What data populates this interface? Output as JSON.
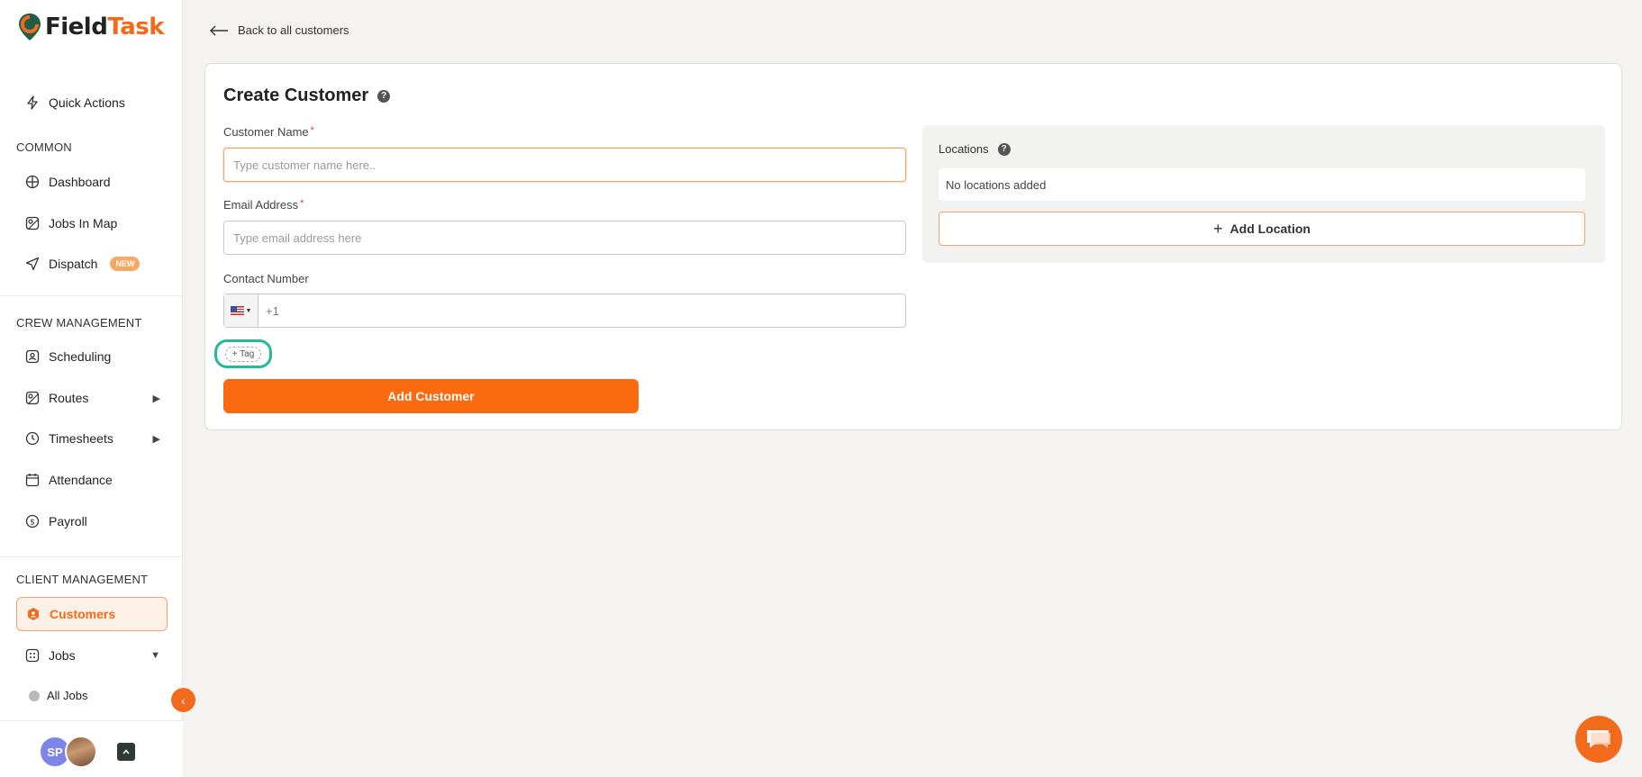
{
  "brand": {
    "name_part1": "Field",
    "name_part2": "Task",
    "accent": "#f26a1b"
  },
  "sidebar": {
    "quick_actions": "Quick Actions",
    "sections": {
      "common": "COMMON",
      "crew": "CREW MANAGEMENT",
      "client": "CLIENT MANAGEMENT"
    },
    "items": {
      "dashboard": "Dashboard",
      "jobs_in_map": "Jobs In Map",
      "dispatch": "Dispatch",
      "dispatch_badge": "NEW",
      "scheduling": "Scheduling",
      "routes": "Routes",
      "timesheets": "Timesheets",
      "attendance": "Attendance",
      "payroll": "Payroll",
      "customers": "Customers",
      "jobs": "Jobs",
      "all_jobs": "All Jobs"
    },
    "user_initials": "SP"
  },
  "header": {
    "back_link": "Back to all customers"
  },
  "form": {
    "title": "Create Customer",
    "customer_name": {
      "label": "Customer Name",
      "placeholder": "Type customer name here..",
      "value": ""
    },
    "email": {
      "label": "Email Address",
      "placeholder": "Type email address here",
      "value": ""
    },
    "contact": {
      "label": "Contact Number",
      "country_code": "+1"
    },
    "tag_button": "+ Tag",
    "submit": "Add Customer"
  },
  "locations": {
    "title": "Locations",
    "empty_text": "No locations added",
    "add_button": "Add Location"
  }
}
